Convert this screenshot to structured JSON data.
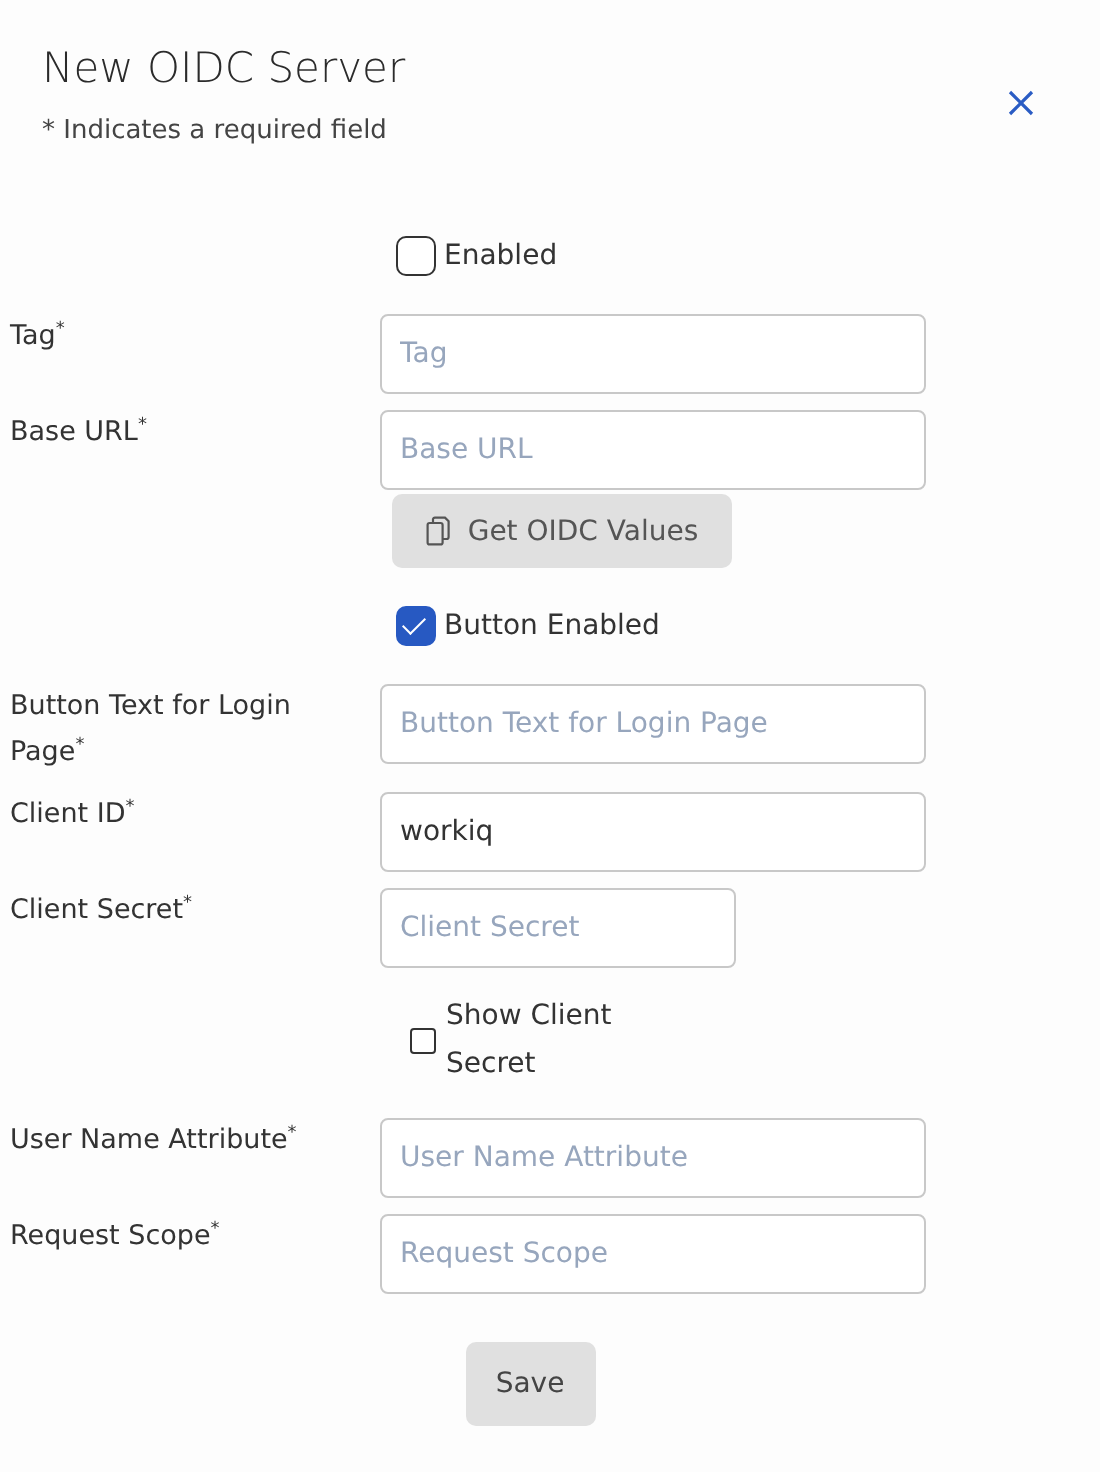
{
  "dialog": {
    "title": "New OIDC Server",
    "note": "* Indicates a required field"
  },
  "rows": [
    {
      "kind": "checkbox",
      "label": "Enabled",
      "checked": false
    },
    {
      "kind": "field",
      "label": "Tag$^{*}$",
      "placeholder": "Tag"
    },
    {
      "kind": "field",
      "label": "Base URL$^{*}$",
      "placeholder": "Base URL"
    },
    {
      "kind": "button",
      "label": "Get OIDC Values"
    },
    {
      "kind": "checkbox",
      "label": "Button Enabled",
      "checked": true
    },
    {
      "kind": "field",
      "label": "Button Text for Login Page$^{*}$",
      "placeholder": "Button Text for Login Page"
    },
    {
      "kind": "field",
      "label": "Client ID$^{*}$",
      "value": "workiq"
    },
    {
      "kind": "shortfield",
      "label": "Client Secret$^{*}$",
      "placeholder": "Client Secret"
    },
    {
      "kind": "minicheckbox",
      "label": "Show Client Secret",
      "checked": false
    },
    {
      "kind": "field",
      "label": "User Name Attribute$^{*}$",
      "placeholder": "User Name Attribute"
    },
    {
      "kind": "field",
      "label": "Request Scope$^{*}$",
      "placeholder": "Request Scope"
    }
  ],
  "save_button": "Save"
}
